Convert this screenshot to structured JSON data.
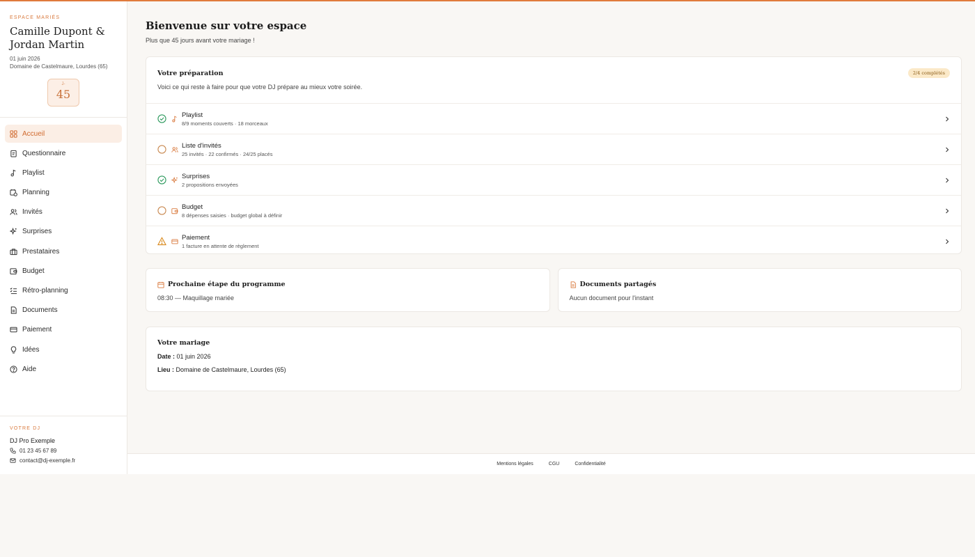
{
  "sidebar": {
    "eyebrow": "ESPACE MARIÉS",
    "couple_name": "Camille Dupont & Jordan Martin",
    "date": "01 juin 2026",
    "venue": "Domaine de Castelmaure, Lourdes (65)",
    "countdown_label": "J-",
    "countdown_value": "45",
    "nav": [
      {
        "label": "Accueil",
        "icon": "grid-icon",
        "active": true
      },
      {
        "label": "Questionnaire",
        "icon": "clipboard-icon"
      },
      {
        "label": "Playlist",
        "icon": "music-note-icon"
      },
      {
        "label": "Planning",
        "icon": "calendar-clock-icon"
      },
      {
        "label": "Invités",
        "icon": "users-icon"
      },
      {
        "label": "Surprises",
        "icon": "sparkles-icon"
      },
      {
        "label": "Prestataires",
        "icon": "briefcase-icon"
      },
      {
        "label": "Budget",
        "icon": "wallet-icon"
      },
      {
        "label": "Rétro-planning",
        "icon": "checklist-icon"
      },
      {
        "label": "Documents",
        "icon": "document-icon"
      },
      {
        "label": "Paiement",
        "icon": "credit-card-icon"
      },
      {
        "label": "Idées",
        "icon": "lightbulb-icon"
      },
      {
        "label": "Aide",
        "icon": "help-circle-icon"
      }
    ],
    "dj": {
      "eyebrow": "VOTRE DJ",
      "name": "DJ Pro Exemple",
      "phone": "01 23 45 67 89",
      "email": "contact@dj-exemple.fr"
    }
  },
  "main": {
    "title": "Bienvenue sur votre espace",
    "subtitle": "Plus que 45 jours avant votre mariage !",
    "prep": {
      "title": "Votre préparation",
      "badge": "2/4 complétés",
      "description": "Voici ce qui reste à faire pour que votre DJ prépare au mieux votre soirée.",
      "tasks": [
        {
          "title": "Playlist",
          "detail": "8/9 moments couverts · 18 morceaux",
          "status": "done",
          "icon": "music-note-icon"
        },
        {
          "title": "Liste d'invités",
          "detail": "25 invités · 22 confirmés · 24/25 placés",
          "status": "todo",
          "icon": "users-icon"
        },
        {
          "title": "Surprises",
          "detail": "2 propositions envoyées",
          "status": "done",
          "icon": "sparkles-icon"
        },
        {
          "title": "Budget",
          "detail": "8 dépenses saisies · budget global à définir",
          "status": "todo",
          "icon": "wallet-icon"
        },
        {
          "title": "Paiement",
          "detail": "1 facture en attente de règlement",
          "status": "warning",
          "icon": "credit-card-icon"
        }
      ]
    },
    "next_step": {
      "title": "Prochaine étape du programme",
      "text": "08:30 — Maquillage mariée"
    },
    "documents": {
      "title": "Documents partagés",
      "text": "Aucun document pour l'instant"
    },
    "wedding": {
      "title": "Votre mariage",
      "date_label": "Date :",
      "date_value": "01 juin 2026",
      "place_label": "Lieu :",
      "place_value": "Domaine de Castelmaure, Lourdes (65)"
    }
  },
  "footer": {
    "links": [
      "Mentions légales",
      "CGU",
      "Confidentialité"
    ]
  },
  "colors": {
    "accent": "#d97a3e",
    "success": "#2e9a5e",
    "warning": "#d98a1e"
  }
}
